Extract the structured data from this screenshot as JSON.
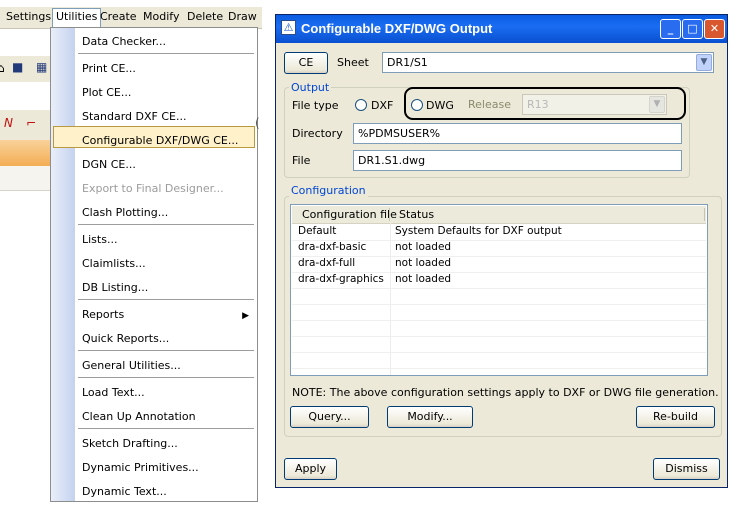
{
  "menubar": {
    "items": [
      "Settings",
      "Utilities",
      "Create",
      "Modify",
      "Delete",
      "Draw"
    ],
    "active": "Utilities"
  },
  "utilities_menu": {
    "items": [
      "Data Checker...",
      "Print CE...",
      "Plot CE...",
      "Standard DXF CE...",
      "Configurable DXF/DWG CE...",
      "DGN CE...",
      "Export to Final Designer...",
      "Clash Plotting...",
      "Lists...",
      "Claimlists...",
      "DB Listing...",
      "Reports",
      "Quick Reports...",
      "General Utilities...",
      "Load Text...",
      "Clean Up Annotation",
      "Sketch Drafting...",
      "Dynamic Primitives...",
      "Dynamic Text..."
    ],
    "highlighted": "Configurable DXF/DWG CE...",
    "disabled": "Export to Final Designer...",
    "submenu": "Reports",
    "submenu_arrow_icon": "triangle-right-icon"
  },
  "dialog": {
    "title": "Configurable DXF/DWG Output",
    "ce_button": "CE",
    "sheet_label": "Sheet",
    "sheet_value": "DR1/S1",
    "output": {
      "group_title": "Output",
      "file_type_label": "File type",
      "dxf_label": "DXF",
      "dwg_label": "DWG",
      "release_label": "Release",
      "release_value": "R13",
      "directory_label": "Directory",
      "directory_value": "%PDMSUSER%",
      "file_label": "File",
      "file_value": "DR1.S1.dwg"
    },
    "configuration": {
      "group_title": "Configuration",
      "columns": [
        "Configuration file",
        "Status"
      ],
      "rows": [
        [
          "Default",
          "System Defaults for DXF output"
        ],
        [
          "dra-dxf-basic",
          "not loaded"
        ],
        [
          "dra-dxf-full",
          "not loaded"
        ],
        [
          "dra-dxf-graphics",
          "not loaded"
        ]
      ],
      "note": "NOTE: The above configuration settings apply to DXF or DWG file generation.",
      "query_button": "Query...",
      "modify_button": "Modify...",
      "rebuild_button": "Re-build"
    },
    "apply_button": "Apply",
    "dismiss_button": "Dismiss"
  },
  "colors": {
    "titlebar": "#0a5be0",
    "menu_highlight": "#fff1c9",
    "group_title": "#0046d5"
  }
}
